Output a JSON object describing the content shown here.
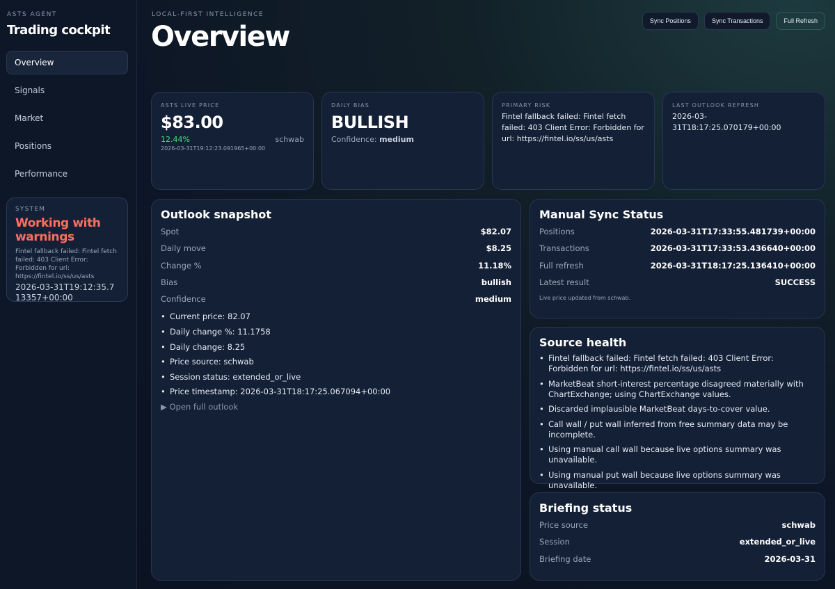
{
  "sidebar": {
    "eyebrow": "ASTS AGENT",
    "title": "Trading cockpit",
    "nav": [
      "Overview",
      "Signals",
      "Market",
      "Positions",
      "Performance"
    ],
    "active": "Overview",
    "system": {
      "eyebrow": "SYSTEM",
      "title": "Working with warnings",
      "message": "Fintel fallback failed: Fintel fetch failed: 403 Client Error: Forbidden for url: https://fintel.io/ss/us/asts",
      "time": "2026-03-31T19:12:35.713357+00:00"
    }
  },
  "header": {
    "eyebrow": "LOCAL-FIRST INTELLIGENCE",
    "title": "Overview",
    "buttons": {
      "sync_positions": "Sync Positions",
      "sync_transactions": "Sync Transactions",
      "full_refresh": "Full Refresh"
    }
  },
  "stats": {
    "price": {
      "label": "ASTS LIVE PRICE",
      "value": "$83.00",
      "change": "12.44%",
      "source": "schwab",
      "time": "2026-03-31T19:12:23.091965+00:00"
    },
    "bias": {
      "label": "DAILY BIAS",
      "value": "BULLISH",
      "confidence_label": "Confidence:",
      "confidence_value": "medium"
    },
    "risk": {
      "label": "PRIMARY RISK",
      "text": "Fintel fallback failed: Fintel fetch failed: 403 Client Error: Forbidden for url: https://fintel.io/ss/us/asts"
    },
    "refresh": {
      "label": "LAST OUTLOOK REFRESH",
      "text": "2026-03-31T18:17:25.070179+00:00"
    }
  },
  "outlook": {
    "title": "Outlook snapshot",
    "rows": [
      {
        "k": "Spot",
        "v": "$82.07"
      },
      {
        "k": "Daily move",
        "v": "$8.25"
      },
      {
        "k": "Change %",
        "v": "11.18%"
      },
      {
        "k": "Bias",
        "v": "bullish"
      },
      {
        "k": "Confidence",
        "v": "medium"
      }
    ],
    "bullets": [
      "Current price: 82.07",
      "Daily change %: 11.1758",
      "Daily change: 8.25",
      "Price source: schwab",
      "Session status: extended_or_live",
      "Price timestamp: 2026-03-31T18:17:25.067094+00:00"
    ],
    "details": "Open full outlook"
  },
  "sync": {
    "title": "Manual Sync Status",
    "rows": [
      {
        "k": "Positions",
        "v": "2026-03-31T17:33:55.481739+00:00"
      },
      {
        "k": "Transactions",
        "v": "2026-03-31T17:33:53.436640+00:00"
      },
      {
        "k": "Full refresh",
        "v": "2026-03-31T18:17:25.136410+00:00"
      },
      {
        "k": "Latest result",
        "v": "SUCCESS"
      }
    ],
    "note": "Live price updated from schwab."
  },
  "health": {
    "title": "Source health",
    "bullets": [
      "Fintel fallback failed: Fintel fetch failed: 403 Client Error: Forbidden for url: https://fintel.io/ss/us/asts",
      "MarketBeat short-interest percentage disagreed materially with ChartExchange; using ChartExchange values.",
      "Discarded implausible MarketBeat days-to-cover value.",
      "Call wall / put wall inferred from free summary data may be incomplete.",
      "Using manual call wall because live options summary was unavailable.",
      "Using manual put wall because live options summary was unavailable."
    ]
  },
  "briefing": {
    "title": "Briefing status",
    "rows": [
      {
        "k": "Price source",
        "v": "schwab"
      },
      {
        "k": "Session",
        "v": "extended_or_live"
      },
      {
        "k": "Briefing date",
        "v": "2026-03-31"
      }
    ]
  }
}
